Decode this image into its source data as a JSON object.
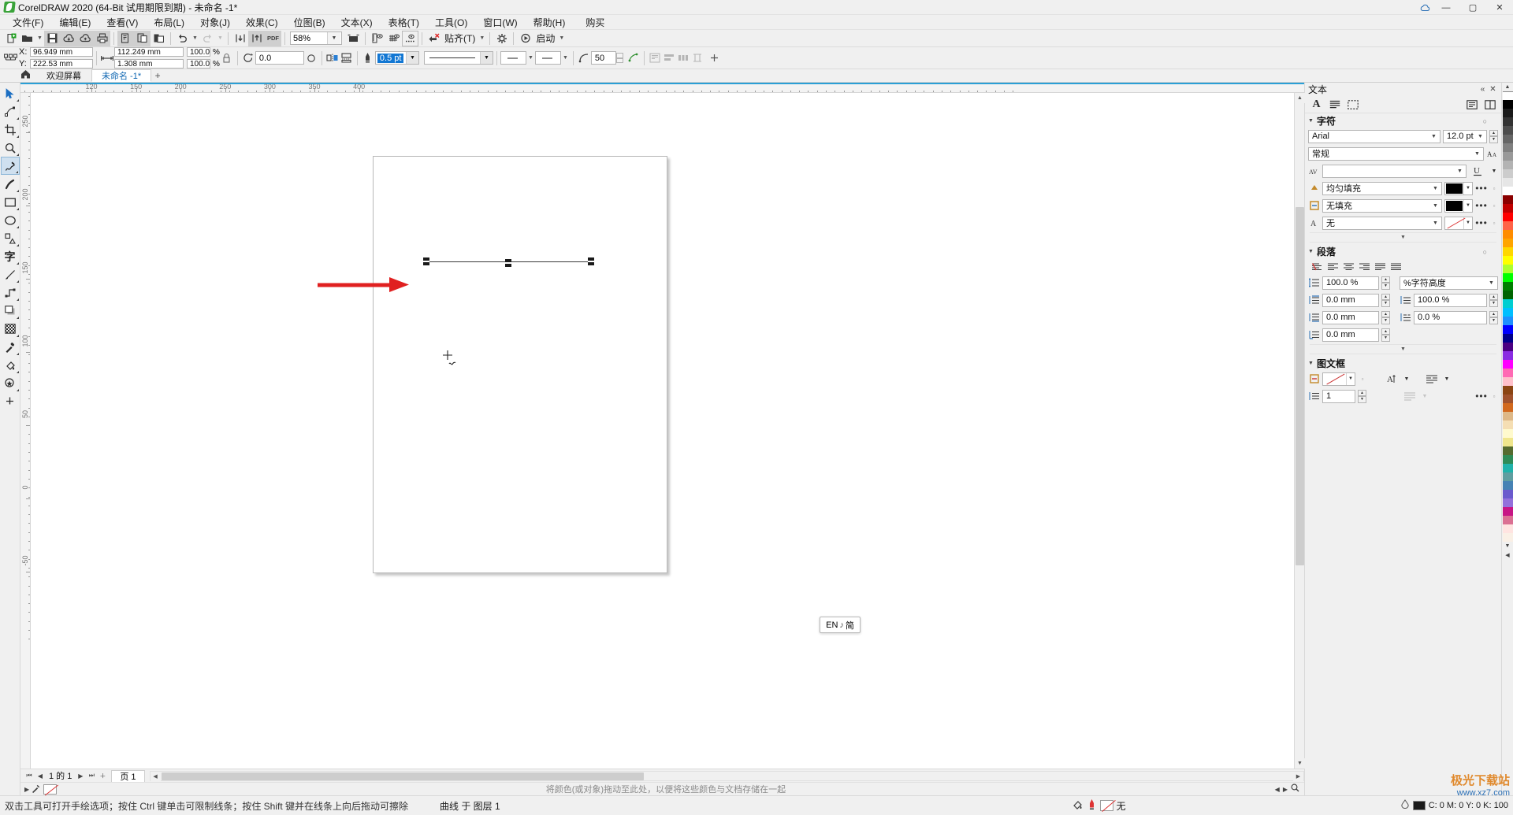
{
  "window": {
    "title": "CorelDRAW 2020 (64-Bit 试用期限到期) - 未命名 -1*",
    "minimize": "—",
    "maximize": "▢",
    "close": "✕",
    "cloud_icon": "cloud-icon",
    "user_icon": "user-icon"
  },
  "menu": {
    "items": [
      "文件(F)",
      "编辑(E)",
      "查看(V)",
      "布局(L)",
      "对象(J)",
      "效果(C)",
      "位图(B)",
      "文本(X)",
      "表格(T)",
      "工具(O)",
      "窗口(W)",
      "帮助(H)"
    ],
    "buy": "购买"
  },
  "toolbar": {
    "zoom_value": "58%",
    "snap_label": "贴齐(T)",
    "launch_label": "启动",
    "items": [
      "new-document-icon",
      "open-icon",
      "save-icon",
      "cloud-download-icon",
      "cloud-upload-icon",
      "print-icon",
      "cut-icon",
      "copy-icon",
      "paste-icon",
      "undo-icon",
      "redo-icon",
      "import-icon",
      "export-icon",
      "export-pdf-icon",
      "zoom-level-combo",
      "fullscreen-icon",
      "rulers-icon",
      "grid-icon",
      "guides-icon",
      "clear-transform-icon",
      "snap-to-button",
      "options-icon",
      "launch-button"
    ]
  },
  "propbar": {
    "x_label": "X:",
    "y_label": "Y:",
    "x_value": "96.949 mm",
    "y_value": "222.53 mm",
    "w_value": "112.249 mm",
    "h_value": "1.308 mm",
    "scale_w": "100.0",
    "scale_h": "100.0",
    "percent": "%",
    "rotate_value": "0.0",
    "outline_width": "0.5 pt",
    "corner_value": "50",
    "lock_ratio_icon": "lock-icon",
    "mirror_h_icon": "mirror-horizontal-icon",
    "mirror_v_icon": "mirror-vertical-icon",
    "line_style": "line-style-combo",
    "start_arrow": "start-arrow-combo",
    "end_arrow": "end-arrow-combo",
    "wrap_icon": "text-wrap-icon",
    "align_icon": "align-objects-icon",
    "weld_icon": "weld-icon",
    "distribute_icon": "distribute-icon",
    "add_icon": "add-icon"
  },
  "tabs": {
    "home_icon": "home-icon",
    "items": [
      {
        "label": "欢迎屏幕",
        "active": false
      },
      {
        "label": "未命名 -1*",
        "active": true
      }
    ],
    "plus": "+"
  },
  "toolbox": {
    "items": [
      {
        "name": "pick-tool",
        "glyph": "pick"
      },
      {
        "name": "shape-tool",
        "glyph": "shape"
      },
      {
        "name": "crop-tool",
        "glyph": "crop"
      },
      {
        "name": "zoom-tool",
        "glyph": "zoom"
      },
      {
        "name": "freehand-tool",
        "glyph": "freehand",
        "active": true
      },
      {
        "name": "artistic-media-tool",
        "glyph": "art"
      },
      {
        "name": "rectangle-tool",
        "glyph": "rect"
      },
      {
        "name": "ellipse-tool",
        "glyph": "ellipse"
      },
      {
        "name": "polygon-tool",
        "glyph": "poly"
      },
      {
        "name": "text-tool",
        "glyph": "text"
      },
      {
        "name": "parallel-dimension-tool",
        "glyph": "dim"
      },
      {
        "name": "connector-tool",
        "glyph": "conn"
      },
      {
        "name": "drop-shadow-tool",
        "glyph": "shadow"
      },
      {
        "name": "transparency-tool",
        "glyph": "transp"
      },
      {
        "name": "color-eyedropper-tool",
        "glyph": "eyedrop"
      },
      {
        "name": "interactive-fill-tool",
        "glyph": "fill"
      },
      {
        "name": "smart-fill-tool",
        "glyph": "smart"
      },
      {
        "name": "more-tools",
        "glyph": "plus"
      }
    ]
  },
  "rulers": {
    "h_unit": "mm",
    "h_ticks": [
      "120",
      "150",
      "200",
      "250",
      "300",
      "350",
      "400"
    ],
    "v_ticks": [
      "250",
      "200",
      "150",
      "100",
      "50",
      "0",
      "-50"
    ]
  },
  "canvas": {
    "page_label": "页 1",
    "object_selected": "curve-with-3-nodes",
    "drop_hint": "将颜色(或对象)拖动至此处，以便将这些颜色与文档存储在一起"
  },
  "pagenav": {
    "first": "⏮",
    "prev": "◀",
    "page_indicator": "1 的 1",
    "next": "▶",
    "last": "⏭",
    "add": "+",
    "page_tab": "页 1"
  },
  "docker": {
    "title": "文本",
    "pin": "«",
    "close": "✕",
    "tabs": [
      "character-tab",
      "paragraph-tab",
      "frame-tab"
    ],
    "sections": {
      "character": {
        "title": "字符",
        "font_family": "Arial",
        "font_size": "12.0 pt",
        "font_style": "常规",
        "kerning_value": "",
        "fill_type_label": "均匀填充",
        "fill_color": "#000000",
        "outline_label": "无填充",
        "outline_color": "#000000",
        "bg_label": "无",
        "bg_color": "#ffffff",
        "underline_icon": "underline-icon",
        "more_icon": "more-options-icon",
        "expand_icon": "expand-icon"
      },
      "paragraph": {
        "title": "段落",
        "align_icons": [
          "no-align-icon",
          "align-left-icon",
          "align-center-icon",
          "align-right-icon",
          "align-justify-icon",
          "align-force-justify-icon"
        ],
        "line_spacing": "100.0 %",
        "line_spacing_unit": "%字符高度",
        "space_before": "0.0 mm",
        "space_after": "0.0 mm",
        "left_indent": "0.0 mm",
        "char_spacing": "100.0 %",
        "word_spacing": "0.0 %"
      },
      "frame": {
        "title": "图文框",
        "frame_color": "#cc2222",
        "columns": "1",
        "vertical_align_icon": "vertical-align-icon",
        "text_flow_icon": "text-flow-icon",
        "more_icon": "more-options-icon"
      }
    }
  },
  "statusbar": {
    "tip": "双击工具可打开手绘选项；按住 Ctrl 键单击可限制线条；按住 Shift 键并在线条上向后拖动可擦除",
    "object_info": "曲线 于 图层 1",
    "drop_hint": "将颜色(或对象)拖动至此处，以便将这些颜色与文档存储在一起",
    "fill_label": "无",
    "color_values": "C: 0 M: 0 Y: 0 K: 100",
    "outline_icon": "outline-pen-icon",
    "fill_icon": "fill-color-icon"
  },
  "ime": {
    "lang": "EN",
    "note": "♪",
    "mode": "简"
  },
  "watermark": {
    "line1": "极光下载站",
    "line2": "www.xz7.com"
  },
  "palette": {
    "colors": [
      "#ffffff",
      "#000000",
      "#1a1a1a",
      "#333333",
      "#4d4d4d",
      "#666666",
      "#808080",
      "#999999",
      "#b3b3b3",
      "#cccccc",
      "#e6e6e6",
      "#ffffff",
      "#8b0000",
      "#c00000",
      "#ff0000",
      "#ff6347",
      "#ff8c00",
      "#ffa500",
      "#ffd700",
      "#ffff00",
      "#adff2f",
      "#00ff00",
      "#008000",
      "#006400",
      "#00ced1",
      "#00bfff",
      "#1e90ff",
      "#0000ff",
      "#00008b",
      "#4b0082",
      "#8a2be2",
      "#ff00ff",
      "#ff69b4",
      "#ffc0cb",
      "#8b4513",
      "#a0522d",
      "#d2691e",
      "#deb887",
      "#f5deb3",
      "#fffacd",
      "#f0e68c",
      "#556b2f",
      "#2e8b57",
      "#20b2aa",
      "#5f9ea0",
      "#4682b4",
      "#6a5acd",
      "#9370db",
      "#c71585",
      "#db7093",
      "#ffe4e1",
      "#faf0e6"
    ]
  }
}
